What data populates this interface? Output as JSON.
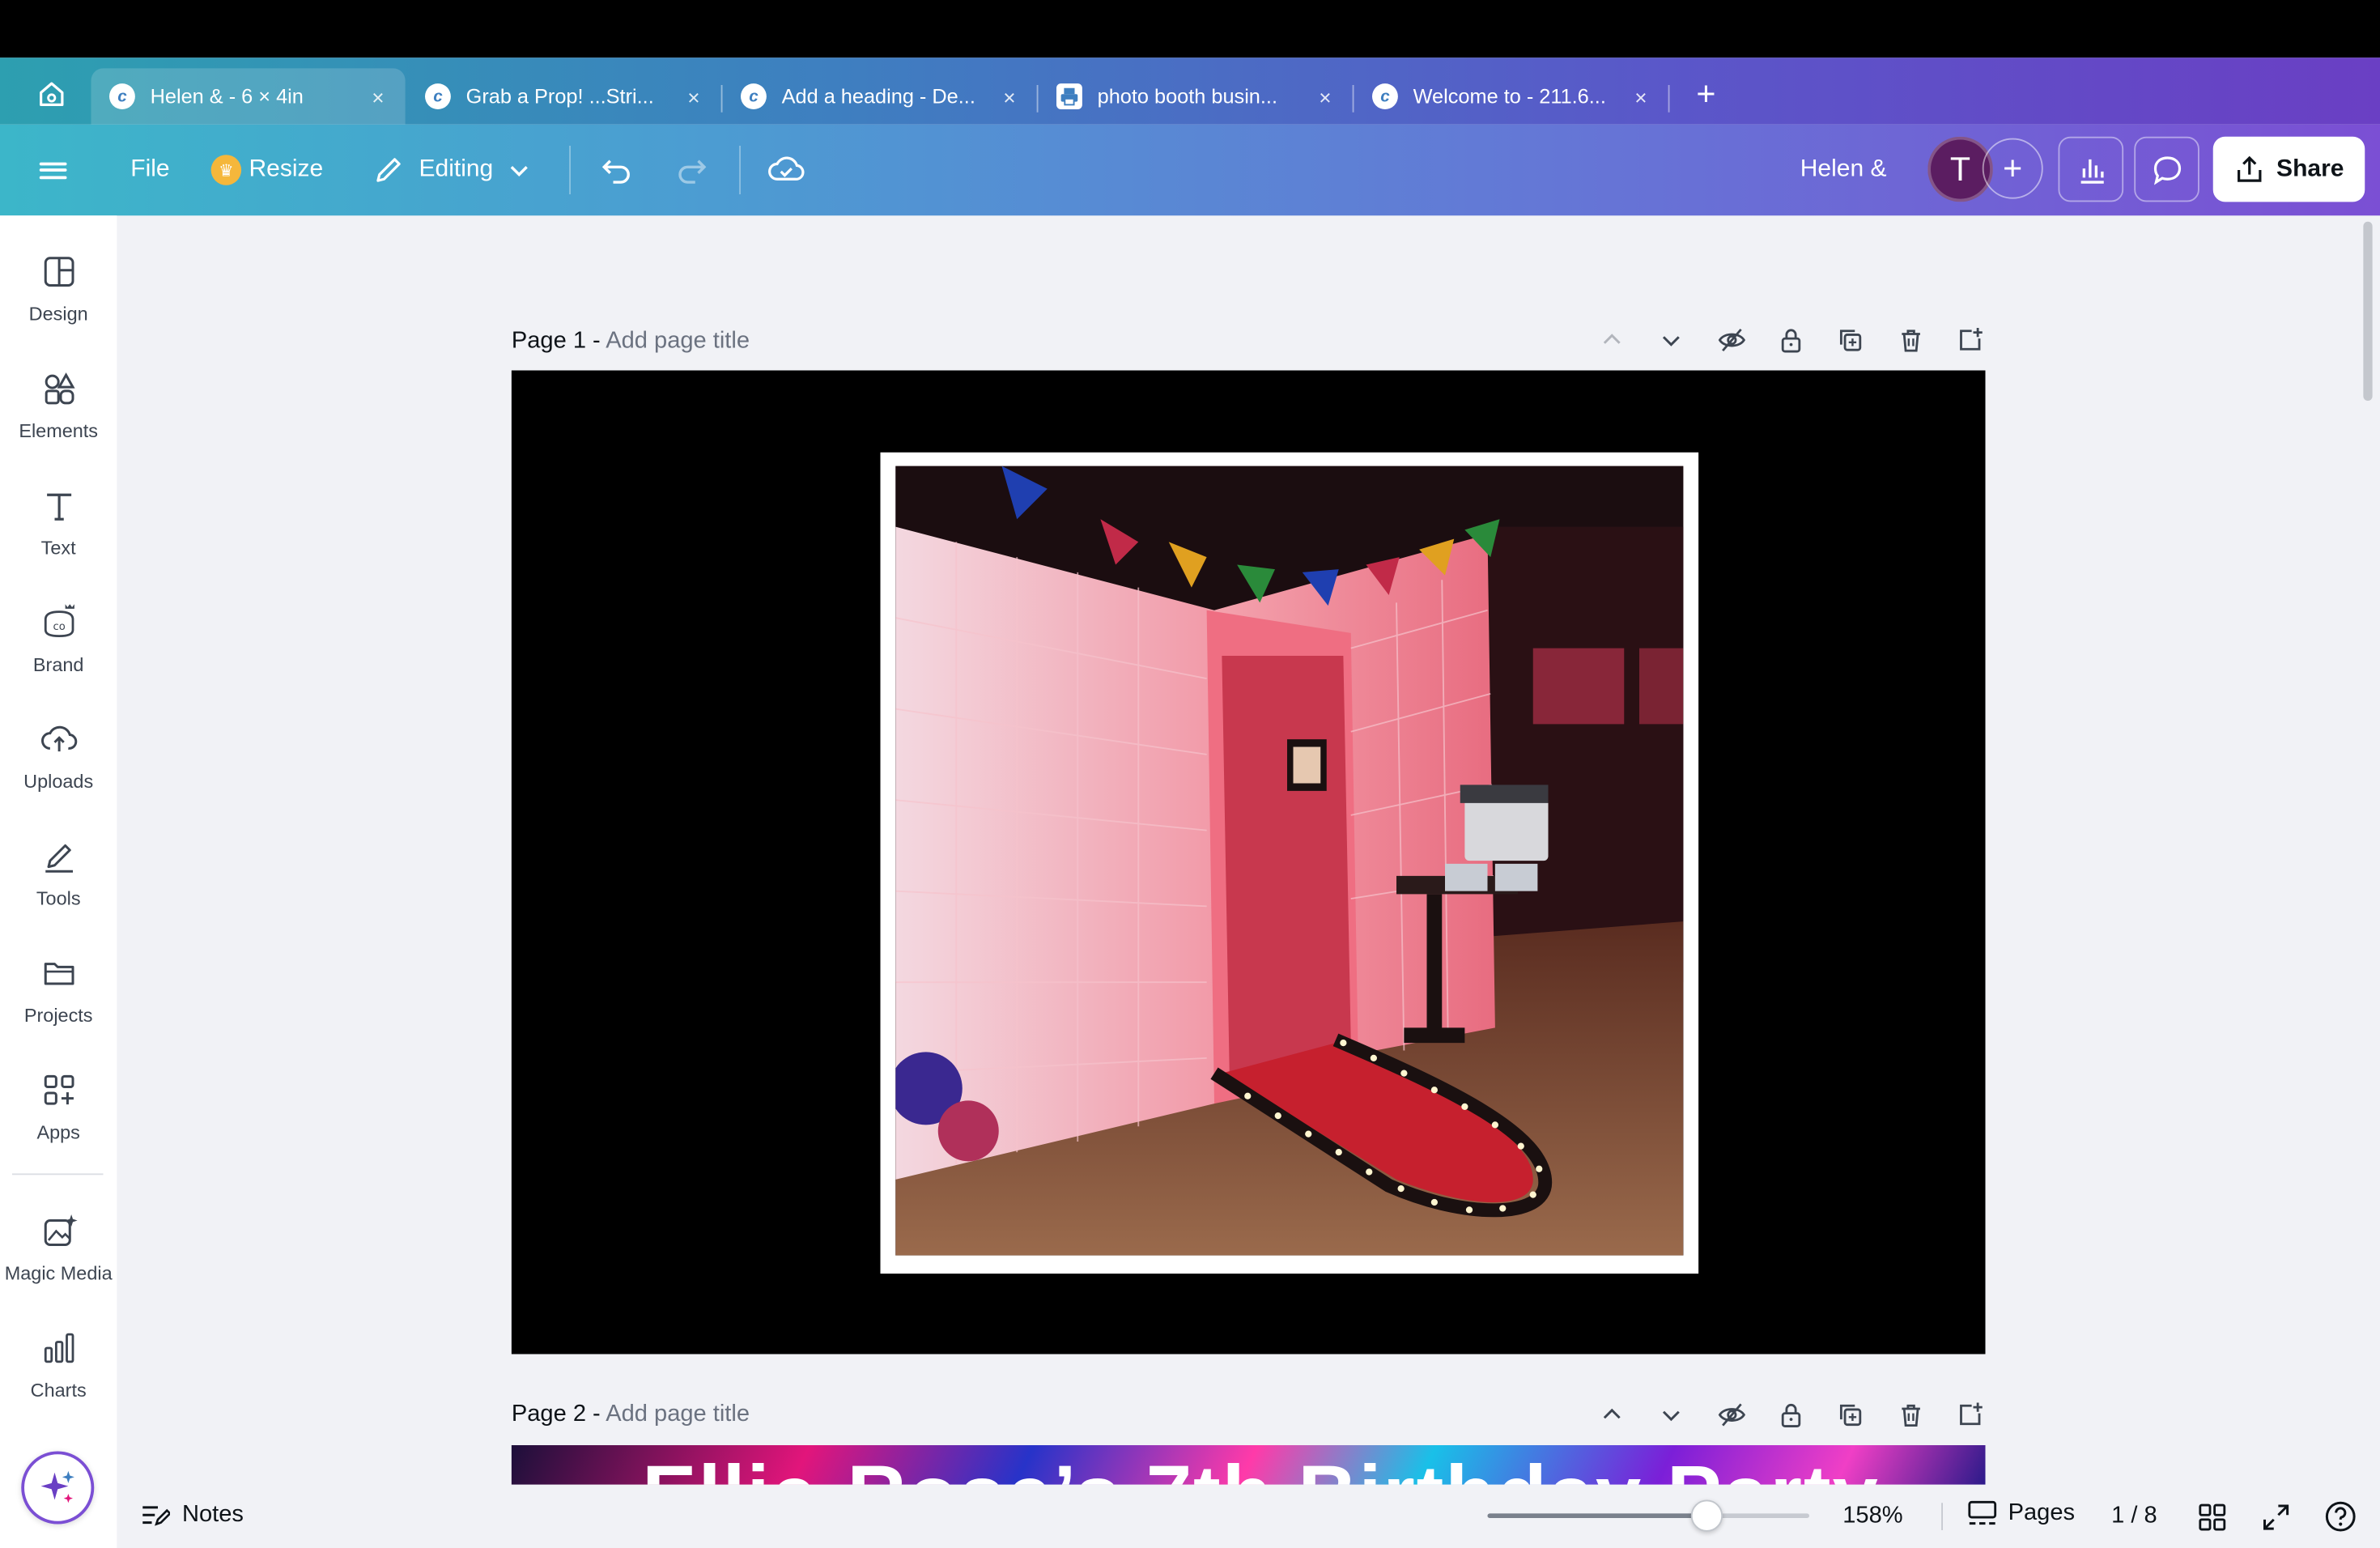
{
  "browser": {
    "tabs": [
      {
        "label": "Helen & - 6 × 4in",
        "icon": "canva-icon",
        "active": true
      },
      {
        "label": "Grab a Prop! ...Stri...",
        "icon": "canva-icon",
        "active": false
      },
      {
        "label": "Add a heading - De...",
        "icon": "canva-icon",
        "active": false
      },
      {
        "label": "photo booth busin...",
        "icon": "printer-icon",
        "active": false
      },
      {
        "label": "Welcome to - 211.6...",
        "icon": "canva-icon",
        "active": false
      }
    ],
    "close_glyph": "×",
    "new_tab_glyph": "+"
  },
  "toolbar": {
    "file_label": "File",
    "resize_label": "Resize",
    "editing_label": "Editing",
    "design_name": "Helen &",
    "avatar_initial": "T",
    "share_label": "Share",
    "accent": "#7b4fd4"
  },
  "sidebar": {
    "items": [
      {
        "label": "Design",
        "icon": "design-icon"
      },
      {
        "label": "Elements",
        "icon": "elements-icon"
      },
      {
        "label": "Text",
        "icon": "text-icon"
      },
      {
        "label": "Brand",
        "icon": "brand-icon"
      },
      {
        "label": "Uploads",
        "icon": "uploads-icon"
      },
      {
        "label": "Tools",
        "icon": "tools-icon"
      },
      {
        "label": "Projects",
        "icon": "projects-icon"
      },
      {
        "label": "Apps",
        "icon": "apps-icon"
      },
      {
        "label": "Magic Media",
        "icon": "magic-media-icon"
      },
      {
        "label": "Charts",
        "icon": "charts-icon"
      }
    ]
  },
  "canvas": {
    "pages": [
      {
        "label": "Page 1 -",
        "title_placeholder": "Add page title"
      },
      {
        "label": "Page 2 -",
        "title_placeholder": "Add page title",
        "heading_preview": "Ellie-Rose’s 7th Birthday Party"
      }
    ]
  },
  "bottombar": {
    "notes_label": "Notes",
    "zoom_percent": "158%",
    "zoom_fraction": 0.68,
    "pages_label": "Pages",
    "page_count": "1 / 8"
  }
}
